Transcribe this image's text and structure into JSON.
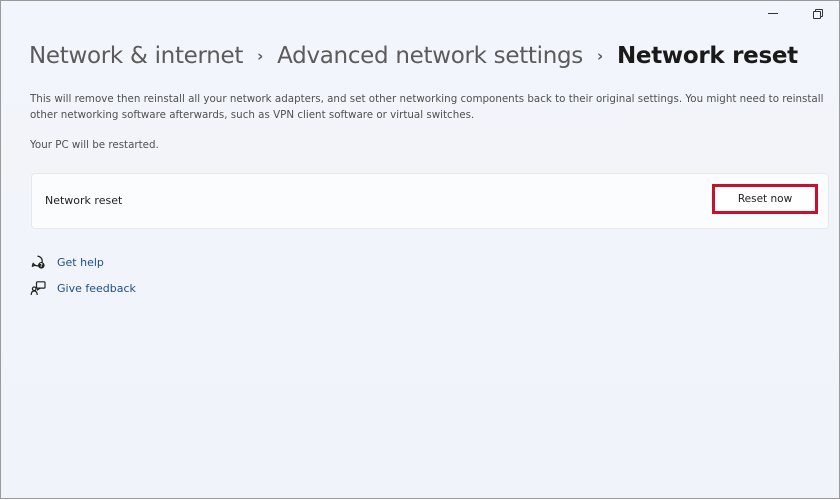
{
  "window": {
    "controls": {
      "minimize_icon": "minimize-icon",
      "restore_icon": "restore-icon"
    }
  },
  "breadcrumb": {
    "items": [
      {
        "label": "Network & internet"
      },
      {
        "label": "Advanced network settings"
      }
    ],
    "current": "Network reset",
    "separator": "›"
  },
  "description": "This will remove then reinstall all your network adapters, and set other networking components back to their original settings. You might need to reinstall other networking software afterwards, such as VPN client software or virtual switches.",
  "restart_note": "Your PC will be restarted.",
  "reset_card": {
    "label": "Network reset",
    "button_label": "Reset now",
    "highlight_color": "#c8102e"
  },
  "links": {
    "get_help": {
      "label": "Get help",
      "icon": "help-chat-icon"
    },
    "give_feedback": {
      "label": "Give feedback",
      "icon": "feedback-icon"
    }
  },
  "colors": {
    "background": "#f2f5fb",
    "link": "#1c4e8a"
  }
}
